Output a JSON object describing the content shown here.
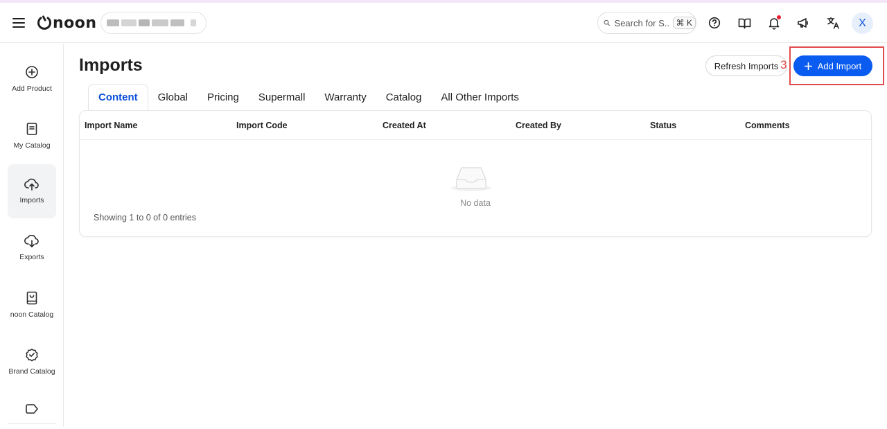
{
  "header": {
    "logo_text": "noon",
    "store_name": "",
    "search_placeholder": "Search for S...",
    "search_shortcut": "⌘ K",
    "avatar_initial": "X",
    "icons": [
      "menu-icon",
      "help-icon",
      "book-icon",
      "bell-icon",
      "megaphone-icon",
      "translate-icon"
    ],
    "notification_dot_color": "#e5202f"
  },
  "sidebar": {
    "items": [
      {
        "label": "Add Product",
        "icon": "plus-circle-icon",
        "active": false
      },
      {
        "label": "My Catalog",
        "icon": "catalog-icon",
        "active": false
      },
      {
        "label": "Imports",
        "icon": "cloud-upload-icon",
        "active": true
      },
      {
        "label": "Exports",
        "icon": "cloud-download-icon",
        "active": false
      },
      {
        "label": "noon Catalog",
        "icon": "noon-catalog-icon",
        "active": false
      },
      {
        "label": "Brand Catalog",
        "icon": "badge-check-icon",
        "active": false
      },
      {
        "label": "",
        "icon": "tag-icon",
        "active": false
      }
    ]
  },
  "page": {
    "title": "Imports",
    "refresh_label": "Refresh Imports",
    "add_label": "Add Import",
    "annotation_number": "3",
    "accent_color": "#0a5bf0",
    "annotation_color": "#e24b4b"
  },
  "tabs": [
    {
      "label": "Content",
      "active": true
    },
    {
      "label": "Global",
      "active": false
    },
    {
      "label": "Pricing",
      "active": false
    },
    {
      "label": "Supermall",
      "active": false
    },
    {
      "label": "Warranty",
      "active": false
    },
    {
      "label": "Catalog",
      "active": false
    },
    {
      "label": "All Other Imports",
      "active": false
    }
  ],
  "table": {
    "columns": [
      "Import Name",
      "Import Code",
      "Created At",
      "Created By",
      "Status",
      "Comments"
    ],
    "rows": [],
    "empty_text": "No data",
    "showing_text": "Showing 1 to 0 of 0 entries"
  }
}
